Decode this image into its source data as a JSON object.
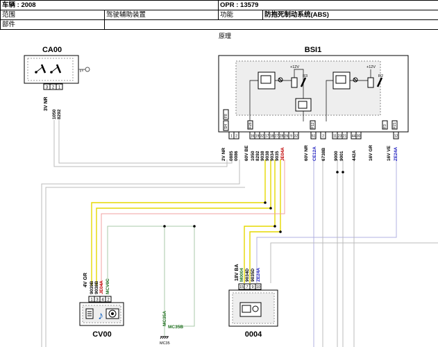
{
  "header": {
    "vehicle": "车辆 : 2008",
    "opr": "OPR : 13579",
    "scope_label": "范围",
    "scope_value": "驾驶辅助装置",
    "function_label": "功能",
    "function_value": "防抱死制动系统(ABS)",
    "part_label": "部件"
  },
  "caption": "原理",
  "ca00": {
    "title": "CA00",
    "pins": [
      "3",
      "2",
      "1"
    ],
    "wire_color": "3V NR",
    "wires": [
      "1050",
      "8292"
    ]
  },
  "bsi1": {
    "title": "BSI1",
    "supply": "+12V",
    "relays": [
      "R3",
      "R2"
    ],
    "fuses": [
      "F8",
      "F28",
      "F12",
      "F3",
      "F21"
    ],
    "sh_label": "SH",
    "pins": [
      "1",
      "2",
      "16",
      "19",
      "32",
      "17",
      "18",
      "27",
      "28",
      "26",
      "9",
      "32",
      "51",
      "2",
      "11",
      "23",
      "21",
      "44",
      "30",
      "12"
    ],
    "wire_groups": [
      {
        "color": "2V NR",
        "wires": [
          "0885",
          "0086"
        ]
      },
      {
        "color": "60V BE",
        "wires": [
          "1050",
          "8292",
          "9038",
          "9038",
          "9034",
          "9035",
          "JE04A"
        ]
      },
      {
        "color": "60V NR",
        "wires": [
          "CE12A"
        ]
      },
      {
        "color": "",
        "wires": [
          "6738B",
          "9000",
          "9001",
          "442A"
        ]
      },
      {
        "color": "16V GR",
        "wires": []
      },
      {
        "color": "16V VE",
        "wires": [
          "ZE24A"
        ]
      }
    ]
  },
  "cv00": {
    "title": "CV00",
    "wire_color": "4V GR",
    "wires": [
      "9039B",
      "9038B",
      "JE04A",
      "MCV0C"
    ],
    "pins": [
      "1",
      "3",
      "4",
      "2"
    ]
  },
  "mc35": {
    "wires": [
      "MC35A",
      "MC35B"
    ],
    "ground": "MC35"
  },
  "c0004": {
    "title": "0004",
    "wire_color": "18V BA",
    "wires": [
      "M0004",
      "9034D",
      "9035D",
      "ZE24A"
    ],
    "pins": [
      "15",
      "7",
      "9",
      "10"
    ]
  }
}
